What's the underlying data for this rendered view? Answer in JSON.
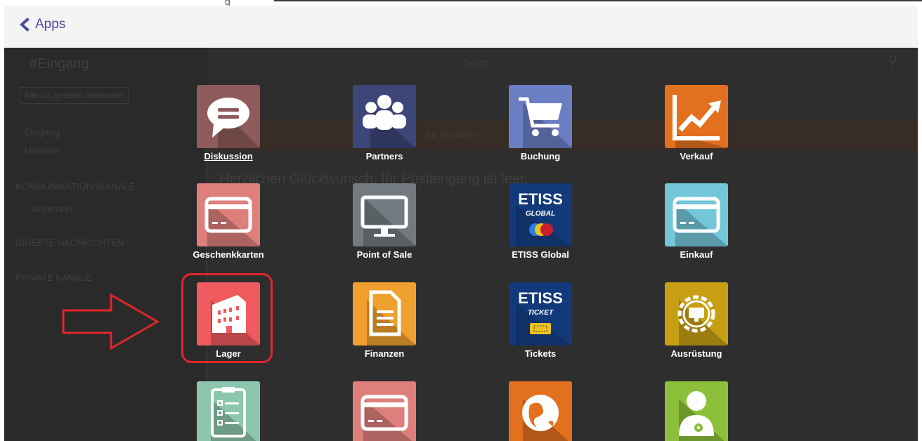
{
  "header": {
    "back_label": "Apps"
  },
  "background": {
    "title": "#Eingang",
    "mark_read": "Alle als gelesen markieren",
    "search_placeholder": "Suche ...",
    "inbox": "Eingang",
    "starred": "Markiert",
    "channels": "KOMMUNIKATIONSKANÄLE",
    "channel_general": "Allgemein",
    "direct_messages": "DIREKTE NACHRICHTEN",
    "private_channels": "PRIVATE KANÄLE",
    "empty_inbox": "Herzlichen Glückwunsch, Ihr Posteingang ist leer.",
    "notice_fragment": "Ihr Browser"
  },
  "apps": [
    {
      "label": "Diskussion",
      "icon": "discussion-icon",
      "color": "#8e5a5a"
    },
    {
      "label": "Partners",
      "icon": "partners-icon",
      "color": "#3d4678"
    },
    {
      "label": "Buchung",
      "icon": "cart-icon",
      "color": "#6b7ec4"
    },
    {
      "label": "Verkauf",
      "icon": "sales-chart-icon",
      "color": "#e3701f"
    },
    {
      "label": "Geschenkkarten",
      "icon": "card-icon",
      "color": "#de7f7b"
    },
    {
      "label": "Point of Sale",
      "icon": "monitor-icon",
      "color": "#737b80"
    },
    {
      "label": "ETISS Global",
      "icon": "etiss-global-icon",
      "color": "#123a7a",
      "logo_text": "ETISS",
      "sub": "GLOBAL"
    },
    {
      "label": "Einkauf",
      "icon": "card-icon",
      "color": "#74c6d9"
    },
    {
      "label": "Lager",
      "icon": "warehouse-icon",
      "color": "#ef5a5e"
    },
    {
      "label": "Finanzen",
      "icon": "document-icon",
      "color": "#f0a02f"
    },
    {
      "label": "Tickets",
      "icon": "etiss-ticket-icon",
      "color": "#123a7a",
      "logo_text": "ETISS",
      "sub": "TICKET"
    },
    {
      "label": "Ausrüstung",
      "icon": "gear-monitor-icon",
      "color": "#c79f12"
    },
    {
      "label": "",
      "icon": "checklist-icon",
      "color": "#8cc7ad"
    },
    {
      "label": "",
      "icon": "card-icon",
      "color": "#de7f7b"
    },
    {
      "label": "",
      "icon": "globe-icon",
      "color": "#e3701f"
    },
    {
      "label": "",
      "icon": "user-gear-icon",
      "color": "#8cbf3a"
    }
  ]
}
